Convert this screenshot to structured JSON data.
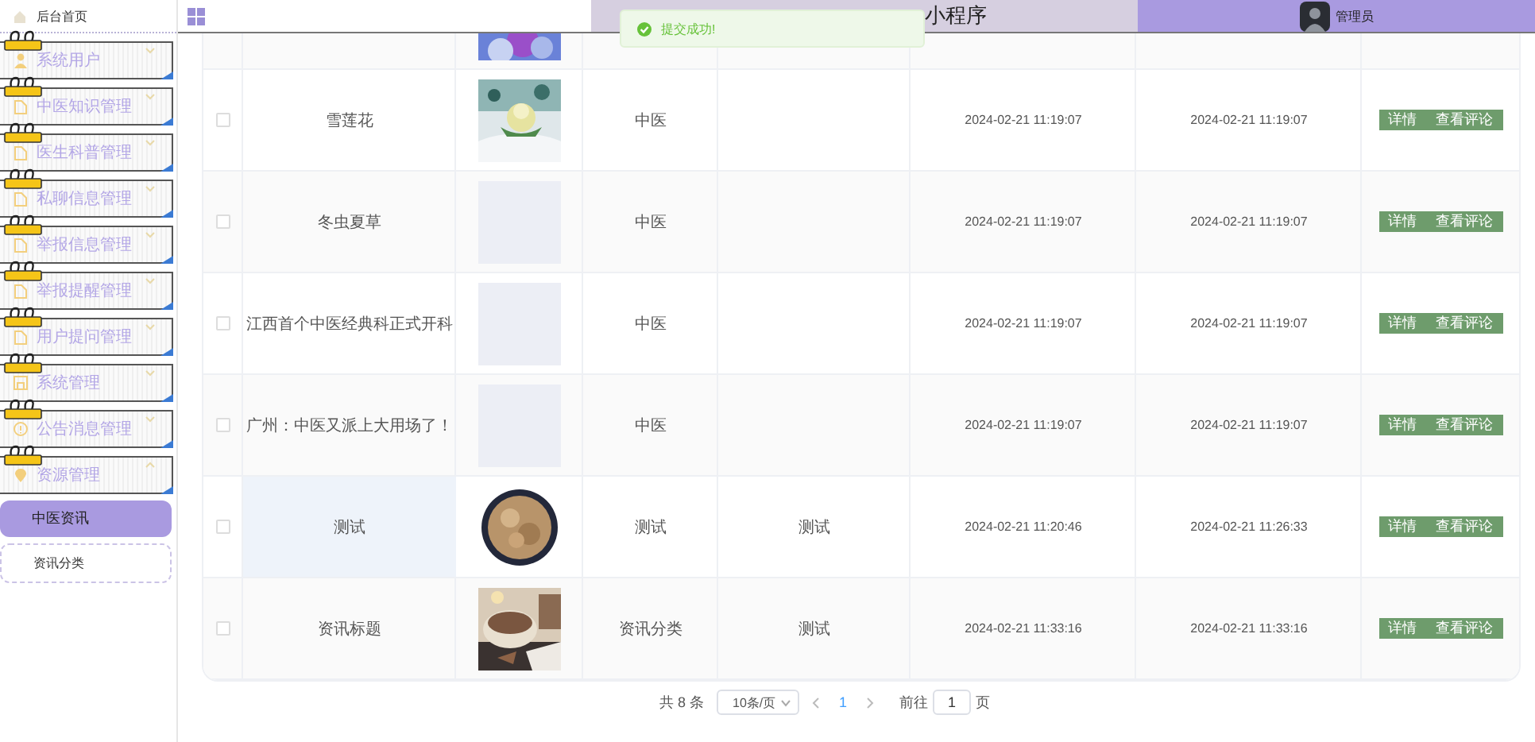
{
  "sidebar": {
    "home": {
      "label": "后台首页"
    },
    "menus": [
      {
        "label": "系统用户",
        "kind": "user",
        "expanded": false
      },
      {
        "label": "中医知识管理",
        "kind": "doc",
        "expanded": false
      },
      {
        "label": "医生科普管理",
        "kind": "doc",
        "expanded": false
      },
      {
        "label": "私聊信息管理",
        "kind": "doc",
        "expanded": false
      },
      {
        "label": "举报信息管理",
        "kind": "doc",
        "expanded": false
      },
      {
        "label": "举报提醒管理",
        "kind": "doc",
        "expanded": false
      },
      {
        "label": "用户提问管理",
        "kind": "doc",
        "expanded": false
      },
      {
        "label": "系统管理",
        "kind": "disk",
        "expanded": false
      },
      {
        "label": "公告消息管理",
        "kind": "info",
        "expanded": false
      },
      {
        "label": "资源管理",
        "kind": "pin",
        "expanded": true
      }
    ],
    "submenu": [
      {
        "label": "中医资讯",
        "selected": true
      },
      {
        "label": "资讯分类",
        "selected": false
      }
    ]
  },
  "header": {
    "title": "小程序",
    "user": "管理员"
  },
  "toast": {
    "message": "提交成功!"
  },
  "table": {
    "rows": [
      {
        "checked": false,
        "highlighted": false,
        "title": "雪莲花",
        "category": "中医",
        "column_4": "",
        "created": "2024-02-21 11:19:07",
        "updated": "2024-02-21 11:19:07",
        "actions": [
          "详情",
          "查看评论"
        ]
      },
      {
        "checked": false,
        "highlighted": false,
        "title": "冬虫夏草",
        "image": {
          "kind": "empty"
        },
        "category": "中医",
        "column_4": "",
        "created": "2024-02-21 11:19:07",
        "updated": "2024-02-21 11:19:07",
        "actions": [
          "详情",
          "查看评论"
        ]
      },
      {
        "checked": false,
        "highlighted": false,
        "title": "江西首个中医经典科正式开科",
        "image": {
          "kind": "empty"
        },
        "category": "中医",
        "column_4": "",
        "created": "2024-02-21 11:19:07",
        "updated": "2024-02-21 11:19:07",
        "actions": [
          "详情",
          "查看评论"
        ]
      },
      {
        "checked": false,
        "highlighted": false,
        "title": "广州：中医又派上大用场了！",
        "image": {
          "kind": "empty"
        },
        "category": "中医",
        "column_4": "",
        "created": "2024-02-21 11:19:07",
        "updated": "2024-02-21 11:19:07",
        "actions": [
          "详情",
          "查看评论"
        ]
      },
      {
        "checked": false,
        "highlighted": true,
        "title": "测试",
        "category": "测试",
        "column_4": "测试",
        "created": "2024-02-21 11:20:46",
        "updated": "2024-02-21 11:26:33",
        "actions": [
          "详情",
          "查看评论"
        ]
      },
      {
        "checked": false,
        "highlighted": false,
        "title": "资讯标题",
        "category": "资讯分类",
        "column_4": "测试",
        "created": "2024-02-21 11:33:16",
        "updated": "2024-02-21 11:33:16",
        "actions": [
          "详情",
          "查看评论"
        ]
      }
    ]
  },
  "pagination": {
    "total": "共 8 条",
    "page_size": "10条/页",
    "pages": [
      {
        "label": "1",
        "selected": true
      }
    ],
    "goto_label": "前往",
    "goto_value": "1",
    "goto_suffix": "页"
  }
}
